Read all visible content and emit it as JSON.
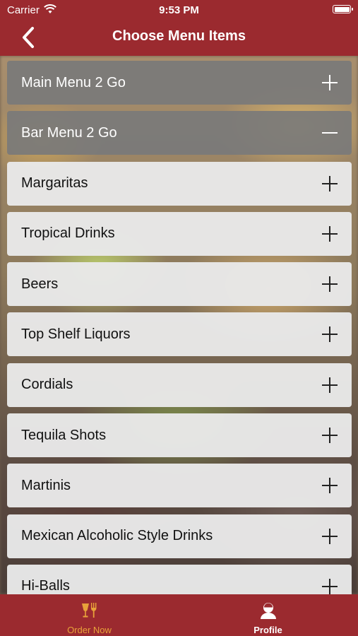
{
  "status_bar": {
    "carrier": "Carrier",
    "time": "9:53 PM"
  },
  "header": {
    "title": "Choose Menu Items"
  },
  "menu": {
    "categories": [
      {
        "label": "Main Menu 2 Go",
        "expanded": false
      },
      {
        "label": "Bar Menu 2 Go",
        "expanded": true
      }
    ],
    "items": [
      {
        "label": "Margaritas"
      },
      {
        "label": "Tropical Drinks"
      },
      {
        "label": "Beers"
      },
      {
        "label": "Top Shelf Liquors"
      },
      {
        "label": "Cordials"
      },
      {
        "label": "Tequila Shots"
      },
      {
        "label": "Martinis"
      },
      {
        "label": "Mexican Alcoholic Style Drinks"
      },
      {
        "label": "Hi-Balls"
      }
    ]
  },
  "tabbar": {
    "tabs": [
      {
        "label": "Order Now",
        "icon": "food-drink-icon",
        "active": true
      },
      {
        "label": "Profile",
        "icon": "profile-icon",
        "active": false
      }
    ]
  },
  "colors": {
    "brand": "#9b2a2f",
    "active_tab": "#e8a23a"
  }
}
